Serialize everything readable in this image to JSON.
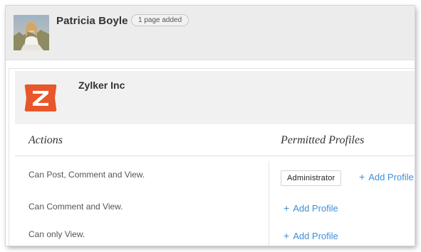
{
  "user": {
    "name": "Patricia Boyle",
    "badge": "1 page added"
  },
  "organization": {
    "name": "Zylker Inc",
    "logo_letter": "Z",
    "logo_color": "#e8562a"
  },
  "table": {
    "columns": [
      "Actions",
      "Permitted Profiles"
    ],
    "rows": [
      {
        "action": "Can Post, Comment and View.",
        "profile": "Administrator",
        "add_label": "Add Profile"
      },
      {
        "action": "Can Comment and View.",
        "add_label": "Add Profile"
      },
      {
        "action": "Can only View.",
        "add_label": "Add Profile"
      }
    ]
  },
  "colors": {
    "link": "#3f8fd6",
    "header_bg": "#ececec",
    "accent": "#e8562a"
  }
}
